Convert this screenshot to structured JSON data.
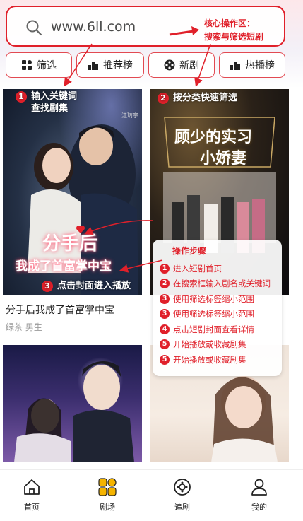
{
  "search": {
    "value": "www.6ll.com"
  },
  "annotation_core": {
    "line1": "核心操作区：",
    "line2": "搜索与筛选短剧"
  },
  "filters": [
    {
      "label": "筛选",
      "icon": "grid-icon"
    },
    {
      "label": "推荐榜",
      "icon": "bar-chart-icon"
    },
    {
      "label": "新剧",
      "icon": "film-reel-icon"
    },
    {
      "label": "热播榜",
      "icon": "bar-chart-icon"
    }
  ],
  "callouts": {
    "c1": {
      "num": "1",
      "line1": "输入关键词",
      "line2": "查找剧集"
    },
    "c2": {
      "num": "2",
      "text": "按分类快速筛选"
    },
    "c3": {
      "num": "3",
      "text": "点击封面进入播放"
    }
  },
  "posters": {
    "p1": {
      "title_art_1": "分手后",
      "title_art_2": "我成了首富掌中宝",
      "badge": "江琦宇"
    },
    "p2": {
      "title_art_1": "顾少的实习",
      "title_art_2": "小娇妻"
    }
  },
  "cards": [
    {
      "title": "分手后我成了首富掌中宝",
      "genre": "绿茶 男生"
    }
  ],
  "steps": {
    "title": "操作步骤",
    "items": [
      {
        "num": "1",
        "text": "进入短剧首页"
      },
      {
        "num": "2",
        "text": "在搜索框输入剧名或关键词"
      },
      {
        "num": "3",
        "text": "使用筛选标签缩小范围"
      },
      {
        "num": "3",
        "text": "使用筛选标签缩小范围"
      },
      {
        "num": "4",
        "text": "点击短剧封面查看详情"
      },
      {
        "num": "5",
        "text": "开始播放或收藏剧集"
      },
      {
        "num": "5",
        "text": "开始播放或收藏剧集"
      }
    ]
  },
  "nav": [
    {
      "label": "首页",
      "icon": "home-icon"
    },
    {
      "label": "剧场",
      "icon": "theater-grid-icon"
    },
    {
      "label": "追剧",
      "icon": "follow-play-icon"
    },
    {
      "label": "我的",
      "icon": "user-icon"
    }
  ],
  "colors": {
    "accent": "#e0202a",
    "nav_active": "#f5b400"
  }
}
